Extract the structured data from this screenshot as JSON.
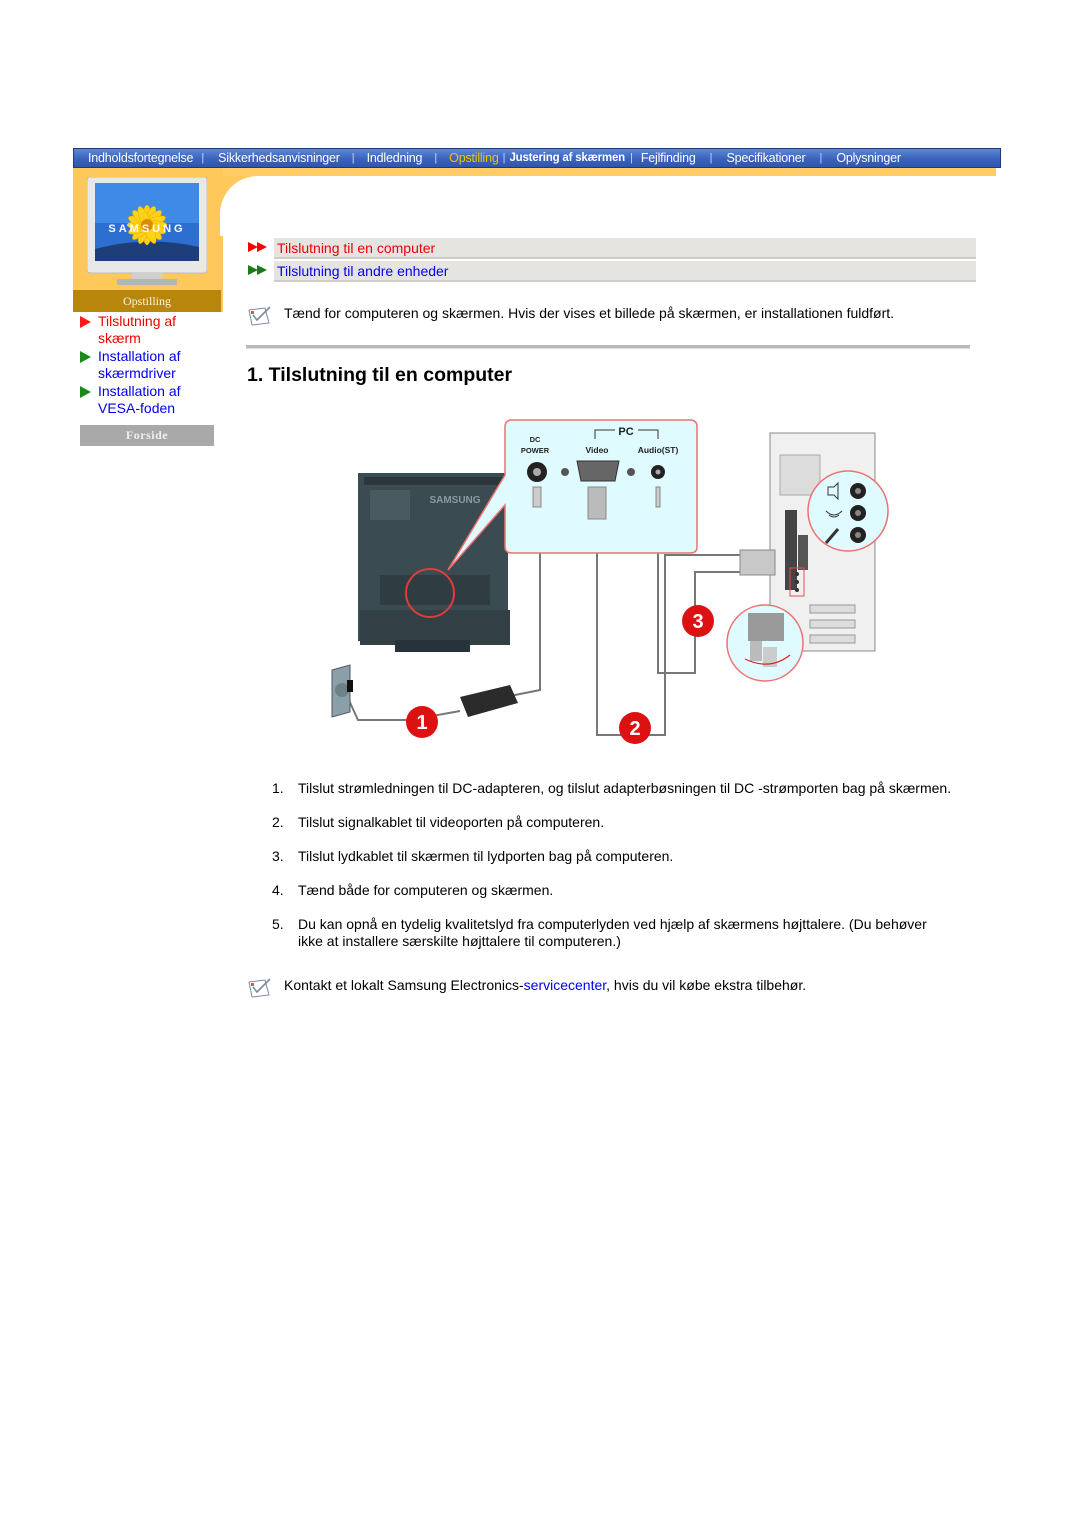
{
  "topnav": {
    "items": [
      {
        "label": "Indholdsfortegnelse",
        "active": false
      },
      {
        "label": "Sikkerhedsanvisninger",
        "active": false
      },
      {
        "label": "Indledning",
        "active": false
      },
      {
        "label": "Opstilling",
        "active": true
      },
      {
        "label": "Justering af skærmen",
        "active": false
      },
      {
        "label": "Fejlfinding",
        "active": false
      },
      {
        "label": "Specifikationer",
        "active": false
      },
      {
        "label": "Oplysninger",
        "active": false
      }
    ],
    "separator": "|"
  },
  "sidebar": {
    "monitor_brand": "SAMSUNG",
    "section_label": "Opstilling",
    "items": [
      {
        "label": "Tilslutning af skærm",
        "active": true
      },
      {
        "label": "Installation af skærmdriver",
        "active": false
      },
      {
        "label": "Installation af VESA-foden",
        "active": false
      }
    ],
    "home_button": "Forside"
  },
  "subnav": [
    {
      "label": "Tilslutning til en computer",
      "active": true
    },
    {
      "label": "Tilslutning til andre enheder",
      "active": false
    }
  ],
  "note_top": "Tænd for computeren og skærmen. Hvis der vises et billede på skærmen, er installationen fuldført.",
  "page_title": "1. Tilslutning til en computer",
  "diagram": {
    "callout_group_label": "PC",
    "port_dc_label_1": "DC",
    "port_dc_label_2": "POWER",
    "port_video_label": "Video",
    "port_audio_label": "Audio(ST)",
    "monitor_brand": "SAMSUNG",
    "markers": [
      "1",
      "2",
      "3"
    ],
    "colors": {
      "callout_fill": "#dffbff",
      "callout_stroke": "#f07070",
      "marker": "#dd1111"
    }
  },
  "steps": [
    {
      "num": "1.",
      "text": "Tilslut strømledningen til DC-adapteren, og tilslut adapterbøsningen til DC -strømporten bag på skærmen."
    },
    {
      "num": "2.",
      "text": "Tilslut signalkablet til videoporten på computeren."
    },
    {
      "num": "3.",
      "text": "Tilslut lydkablet til skærmen til lydporten bag på computeren."
    },
    {
      "num": "4.",
      "text": "Tænd både for computeren og skærmen."
    },
    {
      "num": "5.",
      "text": "Du kan opnå en tydelig kvalitetslyd fra computerlyden ved hjælp af skærmens højttalere. (Du behøver ikke at installere særskilte højttalere til computeren.)"
    }
  ],
  "note_bottom": {
    "before": "Kontakt et lokalt Samsung Electronics-",
    "link": "servicecenter",
    "after": ", hvis du vil købe ekstra tilbehør."
  }
}
